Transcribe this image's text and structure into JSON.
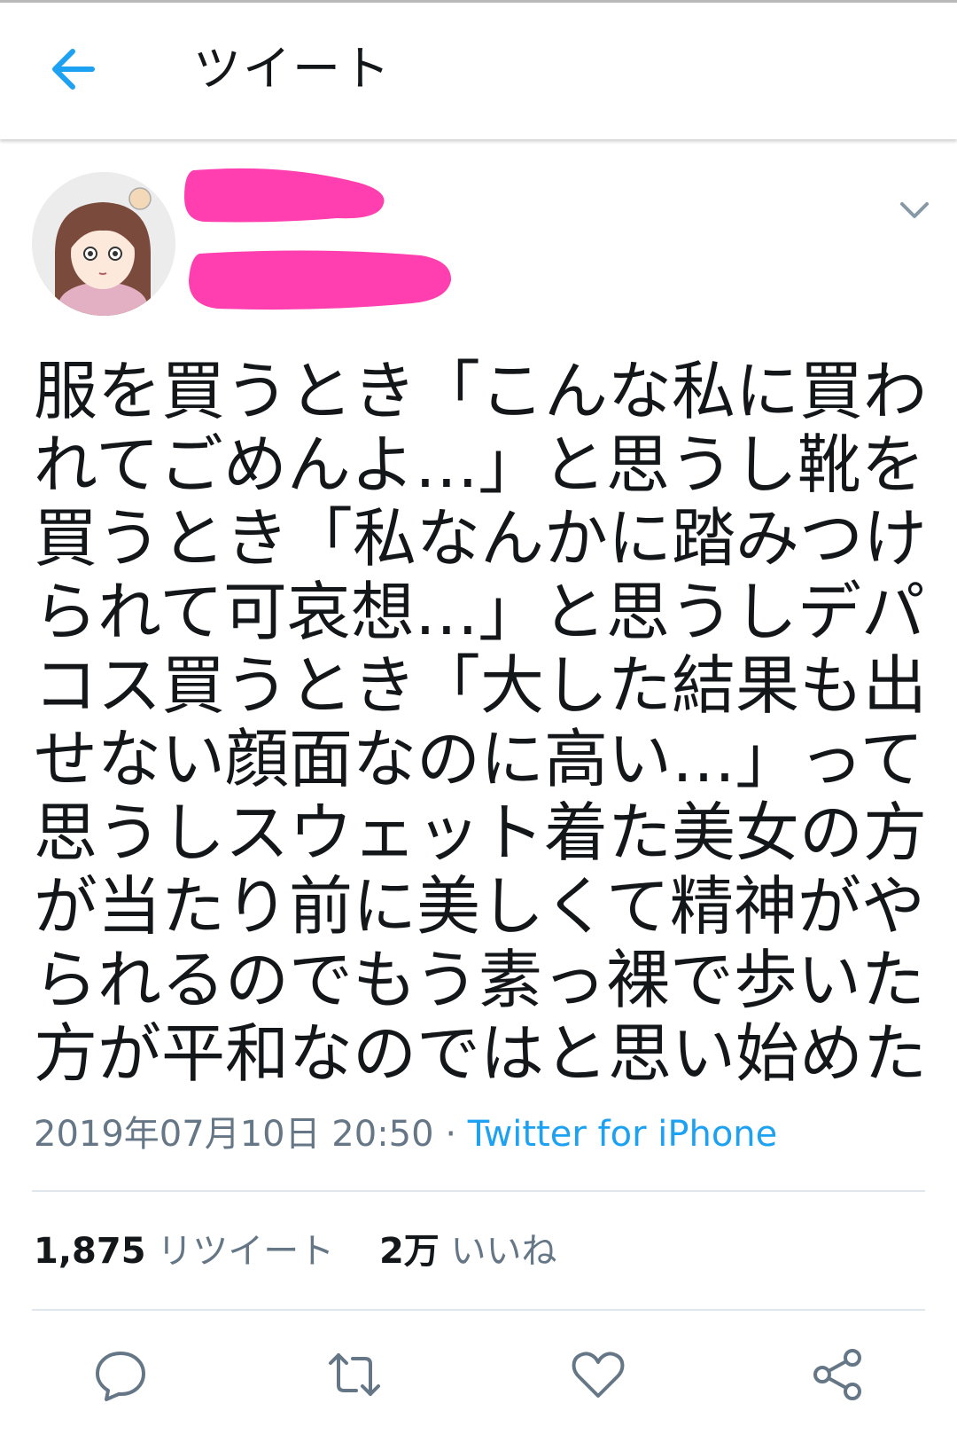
{
  "header": {
    "title": "ツイート",
    "back_icon": "arrow-left-icon",
    "accent_color": "#1da1f2"
  },
  "author": {
    "avatar": "avatar-illustration",
    "name_redacted": true,
    "handle_redacted": true,
    "redaction_color": "#ff3fb0"
  },
  "tweet": {
    "text": "服を買うとき「こんな私に買われてごめんよ…」と思うし靴を買うとき「私なんかに踏みつけられて可哀想…」と思うしデパコス買うとき「大した結果も出せない顔面なのに高い…」って思うしスウェット着た美女の方が当たり前に美しくて精神がやられるのでもう素っ裸で歩いた方が平和なのではと思い始めた",
    "date": "2019年07月10日 20:50",
    "separator": "·",
    "source": "Twitter for iPhone"
  },
  "stats": {
    "retweets_count": "1,875",
    "retweets_label": "リツイート",
    "likes_count": "2万",
    "likes_label": "いいね"
  },
  "actions": [
    "reply-icon",
    "retweet-icon",
    "like-icon",
    "share-icon"
  ]
}
